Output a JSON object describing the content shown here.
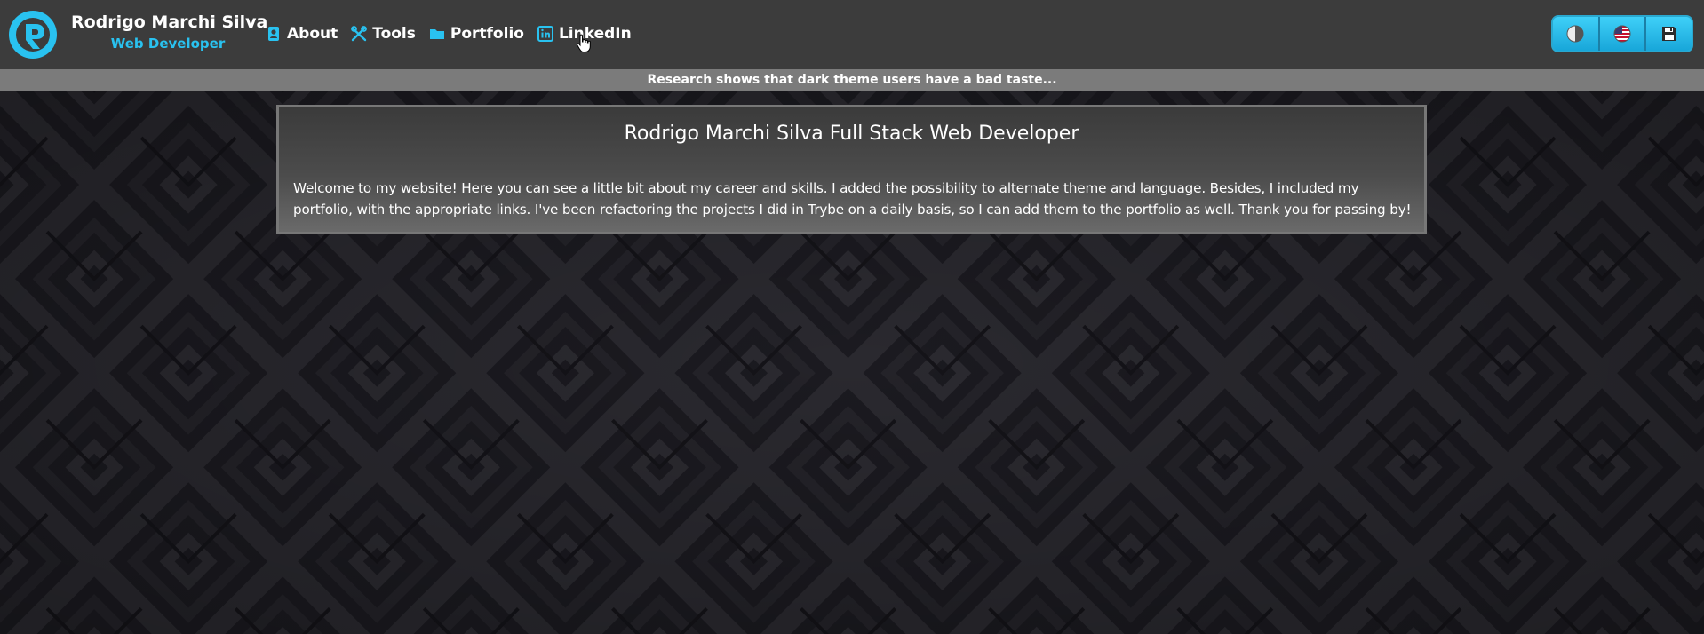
{
  "header": {
    "name": "Rodrigo Marchi Silva",
    "role": "Web Developer",
    "logo_icon": "logo-r-icon"
  },
  "nav": {
    "items": [
      {
        "label": "About",
        "icon": "id-card-icon"
      },
      {
        "label": "Tools",
        "icon": "tools-icon"
      },
      {
        "label": "Portfolio",
        "icon": "folder-icon"
      },
      {
        "label": "LinkedIn",
        "icon": "linkedin-icon"
      }
    ]
  },
  "controls": {
    "buttons": [
      {
        "icon": "theme-toggle-icon"
      },
      {
        "icon": "us-flag-icon"
      },
      {
        "icon": "save-icon"
      }
    ]
  },
  "banner": {
    "text": "Research shows that dark theme users have a bad taste..."
  },
  "main": {
    "title": "Rodrigo Marchi Silva Full Stack Web Developer",
    "text": "Welcome to my website! Here you can see a little bit about my career and skills. I added the possibility to alternate theme and language. Besides, I included my portfolio, with the appropriate links. I've been refactoring the projects I did in Trybe on a daily basis, so I can add them to the portfolio as well. Thank you for passing by!"
  },
  "colors": {
    "accent": "#29c2f0",
    "header_bg": "#3c3c3c",
    "banner_bg": "#7b7b7b",
    "page_bg": "#18171d"
  }
}
